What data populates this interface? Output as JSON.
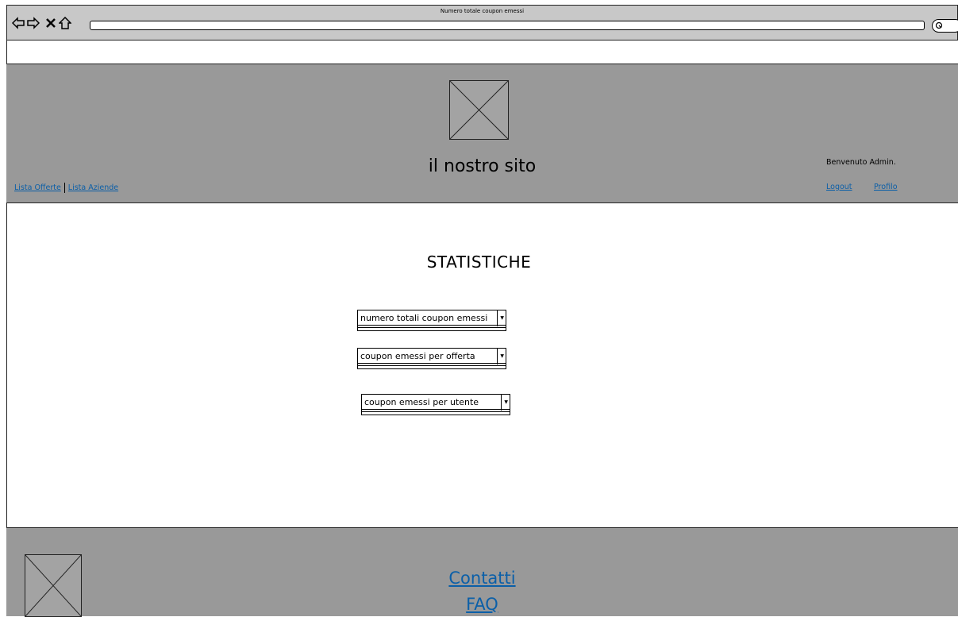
{
  "window": {
    "title": "Numero totale coupon emessi"
  },
  "header": {
    "site_title": "il nostro sito",
    "nav": {
      "offers": "Lista Offerte",
      "companies": "Lista Aziende"
    },
    "welcome": "Benvenuto Admin.",
    "logout": "Logout",
    "profile": "Profilo"
  },
  "main": {
    "title": "STATISTICHE",
    "dropdowns": [
      {
        "selected": "numero totali coupon emessi"
      },
      {
        "selected": "coupon emessi per offerta"
      },
      {
        "selected": "coupon emessi per utente"
      }
    ]
  },
  "footer": {
    "contacts": "Contatti",
    "faq": "FAQ"
  },
  "icons": [
    "back-arrow-icon",
    "forward-arrow-icon",
    "close-icon",
    "home-icon",
    "search-icon",
    "image-placeholder-icon"
  ],
  "colors": {
    "header_bg": "#999999",
    "link": "#0b5fa8"
  }
}
